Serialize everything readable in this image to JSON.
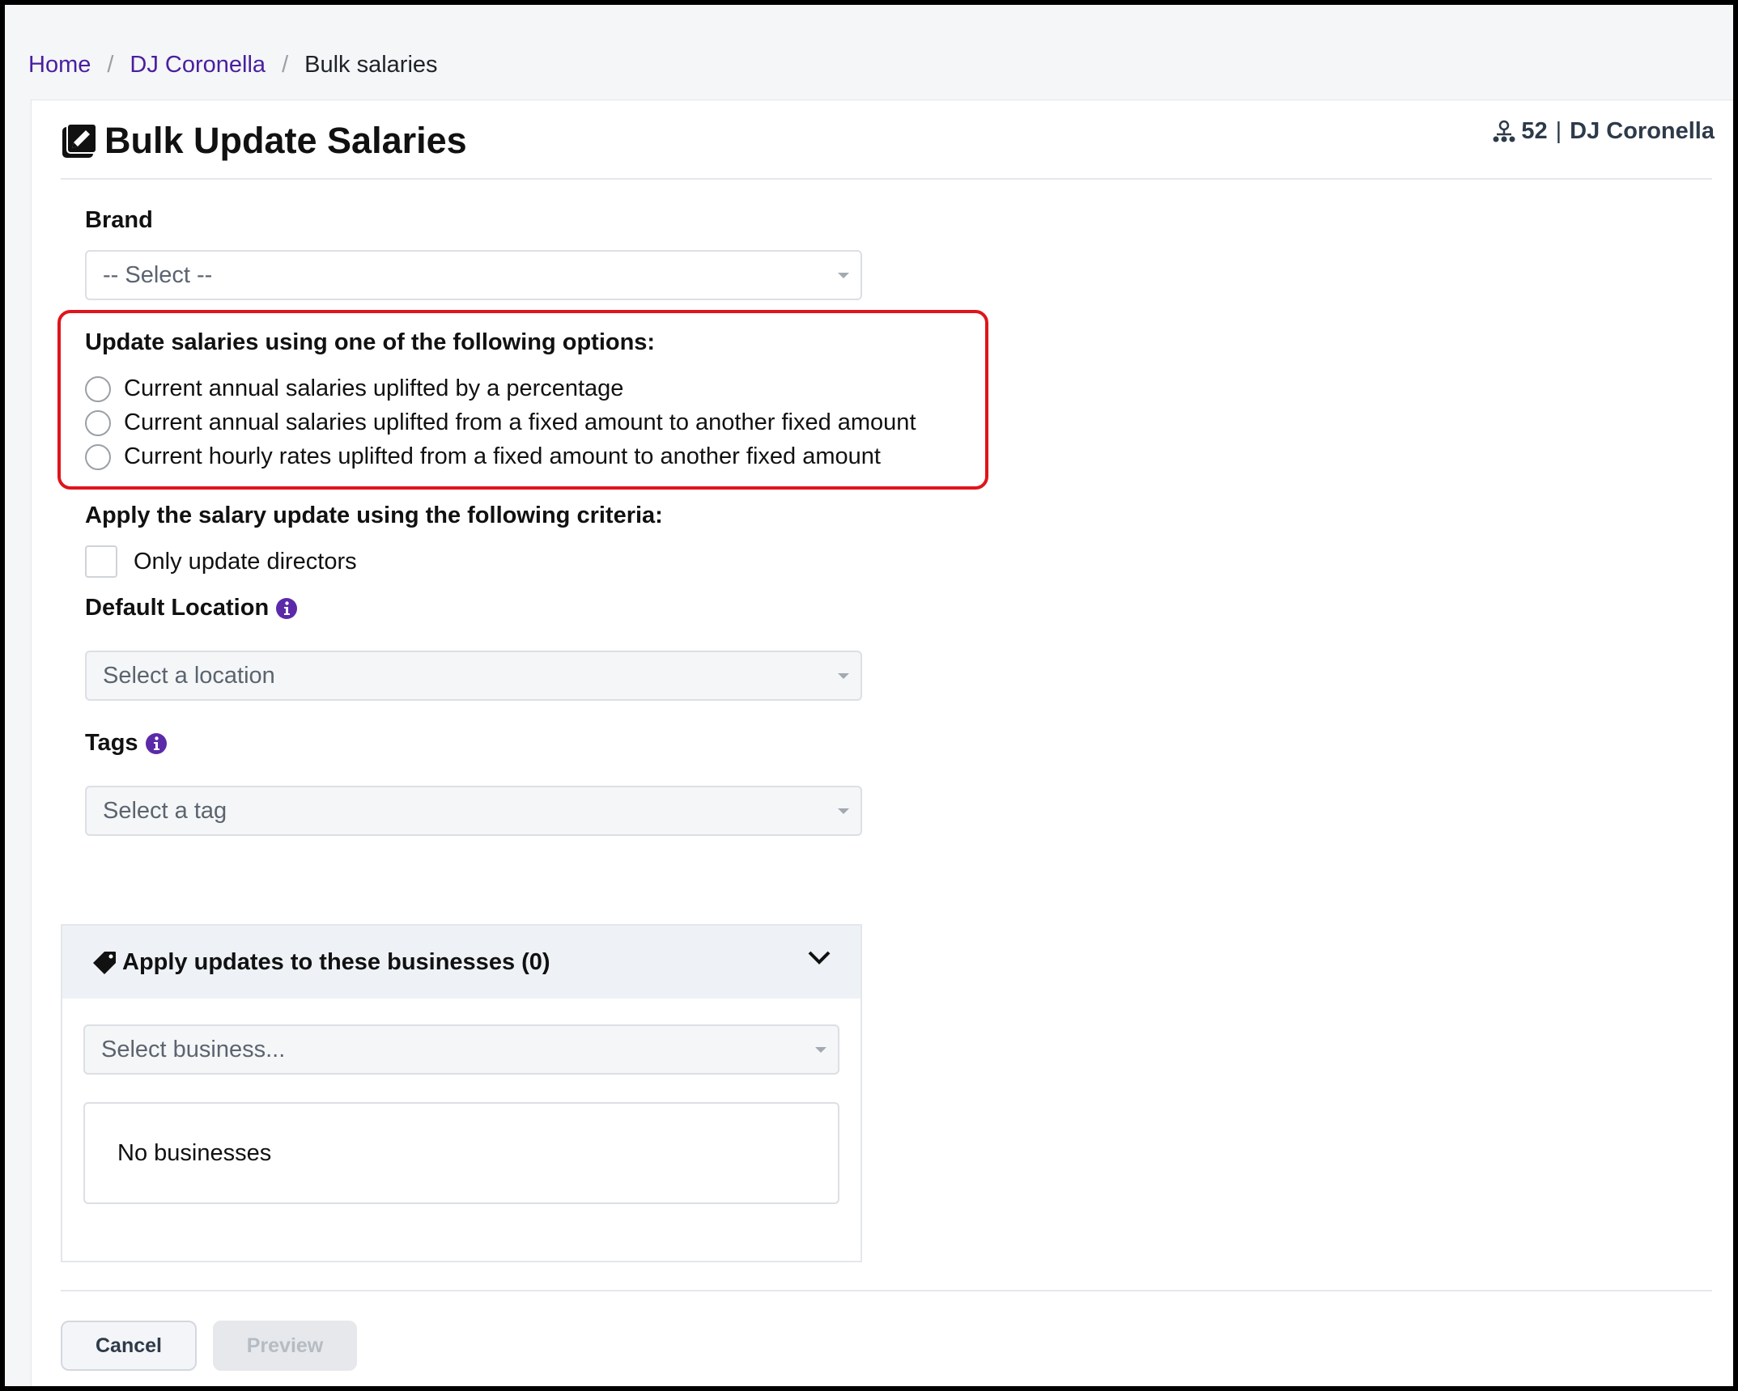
{
  "breadcrumb": {
    "home": "Home",
    "company": "DJ Coronella",
    "current": "Bulk salaries",
    "separator": "/"
  },
  "header": {
    "title": "Bulk Update Salaries",
    "title_icon": "edit-square-icon",
    "org_icon": "org-structure-icon",
    "org_count": "52",
    "org_separator": "|",
    "org_name": "DJ Coronella"
  },
  "form": {
    "brand_label": "Brand",
    "brand_placeholder": "-- Select --",
    "options_heading": "Update salaries using one of the following options:",
    "options": [
      "Current annual salaries uplifted by a percentage",
      "Current annual salaries uplifted from a fixed amount to another fixed amount",
      "Current hourly rates uplifted from a fixed amount to another fixed amount"
    ],
    "criteria_heading": "Apply the salary update using the following criteria:",
    "only_directors_label": "Only update directors",
    "location_label": "Default Location",
    "location_placeholder": "Select a location",
    "tags_label": "Tags",
    "tags_placeholder": "Select a tag"
  },
  "businesses": {
    "heading": "Apply updates to these businesses (0)",
    "select_placeholder": "Select business...",
    "empty_text": "No businesses"
  },
  "footer": {
    "cancel_label": "Cancel",
    "preview_label": "Preview"
  },
  "colors": {
    "link": "#4a1f9e",
    "highlight_border": "#e0141b",
    "info_icon": "#5b2aa8"
  }
}
